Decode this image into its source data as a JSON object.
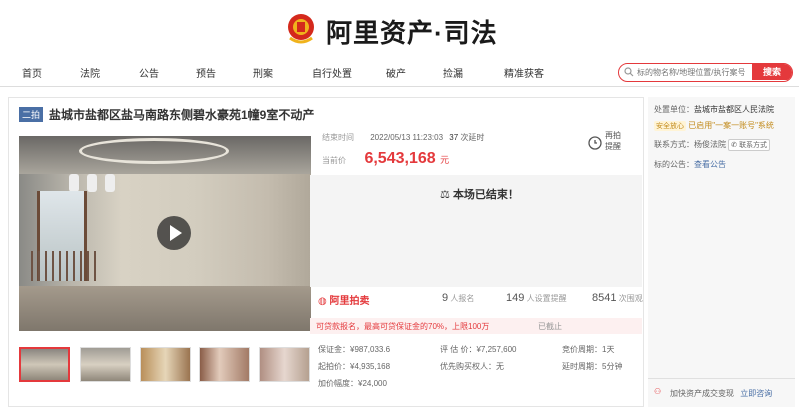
{
  "header": {
    "brand": "阿里资产·司法"
  },
  "nav": [
    "首页",
    "法院",
    "公告",
    "预告",
    "刑案",
    "自行处置",
    "破产",
    "捡漏",
    "精准获客"
  ],
  "search": {
    "placeholder": "标的物名称/地理位置/执行案号",
    "button": "搜索"
  },
  "lot": {
    "round": "二拍",
    "title": "盐城市盐都区盐马南路东侧碧水豪苑1幢9室不动产",
    "end_label": "结束时间",
    "end_time": "2022/05/13 11:23:03",
    "extensions": "37",
    "extension_suffix": "次延时",
    "price_label": "当前价",
    "price": "6,543,168",
    "currency": "元",
    "remind": [
      "再拍",
      "提醒"
    ],
    "ended_text": "本场已结束！",
    "platform": "阿里拍卖",
    "stats": [
      {
        "num": "9",
        "label": "人报名"
      },
      {
        "num": "149",
        "label": "人设置提醒"
      },
      {
        "num": "8541",
        "label": "次围观"
      }
    ],
    "warn_text": "可贷款报名，最高可贷保证金的70%，上限100万",
    "warn_status": "已截止",
    "details": [
      "保证金：¥987,033.6",
      "评 估 价：¥7,257,600",
      "竞价周期：1天",
      "起拍价：¥4,935,168",
      "优先购买权人：无",
      "延时周期：5分钟",
      "加价幅度：¥24,000"
    ]
  },
  "side": {
    "court_label": "处置单位：",
    "court": "盐城市盐都区人民法院",
    "safe_badge": "安全放心",
    "system": "已启用\"一案一账号\"系统",
    "contact_label": "联系方式：",
    "contact": "杨俊法院",
    "contact_btn": "联系方式",
    "notice_label": "标的公告：",
    "notice_link": "查看公告",
    "bottom": "加快资产成交变现",
    "bottom_link": "立即咨询"
  },
  "colors": {
    "accent": "#e4393c",
    "round_badge": "#4a6fa5"
  }
}
